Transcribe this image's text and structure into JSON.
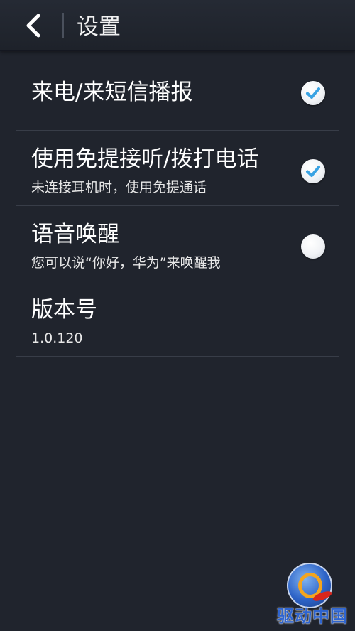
{
  "header": {
    "title": "设置",
    "back_icon": "chevron-left-icon"
  },
  "settings": [
    {
      "title": "来电/来短信播报",
      "subtitle": "",
      "checked": true
    },
    {
      "title": "使用免提接听/拨打电话",
      "subtitle": "未连接耳机时，使用免提通话",
      "checked": true
    },
    {
      "title": "语音唤醒",
      "subtitle": "您可以说“你好，华为”来唤醒我",
      "checked": false
    },
    {
      "title": "版本号",
      "subtitle": "1.0.120",
      "checked": null
    }
  ],
  "watermark": {
    "text": "驱动中国"
  },
  "colors": {
    "background": "#20242d",
    "divider": "#383d48",
    "check_accent": "#3aa3e3"
  }
}
